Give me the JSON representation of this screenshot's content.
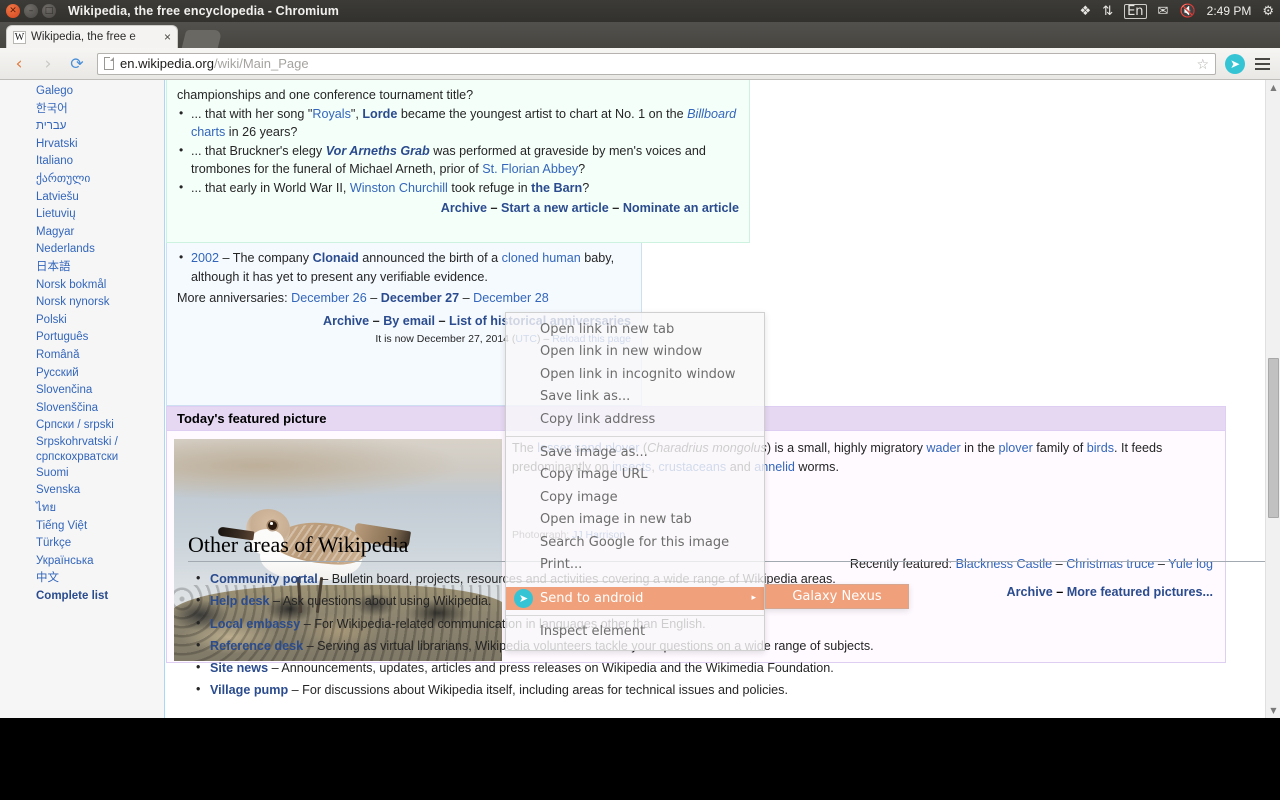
{
  "window": {
    "title": "Wikipedia, the free encyclopedia - Chromium",
    "buttons": {
      "close": "close-button",
      "minimize": "minimize-button",
      "maximize": "maximize-button"
    }
  },
  "tray": {
    "dropbox": "❖",
    "network": "⇅",
    "keyboard": "En",
    "mail": "✉",
    "volume": "🔇",
    "clock": "2:49 PM",
    "system": "⚙"
  },
  "tab": {
    "favicon": "W",
    "title": "Wikipedia, the free e",
    "close": "×"
  },
  "toolbar": {
    "back": "‹",
    "forward": "›",
    "reload": "⟳",
    "url_host": "en.wikipedia.org",
    "url_path": "/wiki/Main_Page",
    "bookmark_star": "☆",
    "telegram": "➤",
    "menu": "menu"
  },
  "sidebar": {
    "languages": [
      {
        "label": "Galego"
      },
      {
        "label": "한국어"
      },
      {
        "label": "עברית"
      },
      {
        "label": "Hrvatski"
      },
      {
        "label": "Italiano"
      },
      {
        "label": "ქართული"
      },
      {
        "label": "Latviešu"
      },
      {
        "label": "Lietuvių"
      },
      {
        "label": "Magyar"
      },
      {
        "label": "Nederlands"
      },
      {
        "label": "日本語"
      },
      {
        "label": "Norsk bokmål"
      },
      {
        "label": "Norsk nynorsk"
      },
      {
        "label": "Polski"
      },
      {
        "label": "Português"
      },
      {
        "label": "Română"
      },
      {
        "label": "Русский"
      },
      {
        "label": "Slovenčina"
      },
      {
        "label": "Slovenščina"
      },
      {
        "label": "Српски / srpski"
      },
      {
        "label": "Srpskohrvatski / српскохрватски"
      },
      {
        "label": "Suomi"
      },
      {
        "label": "Svenska"
      },
      {
        "label": "ไทย"
      },
      {
        "label": "Tiếng Việt"
      },
      {
        "label": "Türkçe"
      },
      {
        "label": "Українська"
      },
      {
        "label": "中文"
      },
      {
        "label": "Complete list",
        "bold": true
      }
    ]
  },
  "did_you_know": {
    "continuation": "championships and one conference tournament title?",
    "items": [
      {
        "p1": "... that with her song \"",
        "l1": "Royals",
        "p2": "\", ",
        "l2": "Lorde",
        "p3": " became the youngest artist to chart at No. 1 on the ",
        "l3": "Billboard",
        "p4": " ",
        "l4": "charts",
        "p5": " in 26 years?"
      },
      {
        "p1": "... that Bruckner's elegy ",
        "l1": "Vor Arneths Grab",
        "p2": " was performed at graveside by men's voices and trombones for the funeral of Michael Arneth, prior of ",
        "l2": "St. Florian Abbey",
        "p3": "?"
      },
      {
        "p1": "... that early in World War II, ",
        "l1": "Winston Churchill",
        "p2": " took refuge in ",
        "l2": "the Barn",
        "p3": "?"
      }
    ],
    "footer": {
      "archive": "Archive",
      "sep": " – ",
      "start": "Start a new article",
      "nominate": "Nominate an article"
    }
  },
  "on_this_day": {
    "item": {
      "year": "2002",
      "dash": " – The company ",
      "link1": "Clonaid",
      "mid": " announced the birth of a ",
      "link2": "cloned human",
      "tail": " baby, although it has yet to present any verifiable evidence."
    },
    "more_label": "More anniversaries: ",
    "dates": [
      "December 26",
      "December 27",
      "December 28"
    ],
    "footer": {
      "archive": "Archive",
      "byemail": "By email",
      "list": "List of historical anniversaries"
    },
    "now_prefix": "It is now December 27, 2014 (",
    "now_utc": "UTC",
    "now_sep": ") – ",
    "reload": "Reload this page"
  },
  "featured_picture": {
    "heading": "Today's featured picture",
    "caption": {
      "p0": "The ",
      "l1": "lesser sand plover",
      "p1": " (",
      "i1": "Charadrius mongolus",
      "p2": ") is a small, highly migratory ",
      "l2": "wader",
      "p3": " in the ",
      "l3": "plover",
      "p4": " family of ",
      "l4": "birds",
      "p5": ". It feeds predominantly on ",
      "l5": "insects",
      "p6": ", ",
      "l6": "crustaceans",
      "p7": " and ",
      "l7": "annelid",
      "p8": " worms."
    },
    "photograph_label": "Photograph: ",
    "photograph_credit": "JJ Harrison",
    "recent_label": "Recently featured: ",
    "recent": [
      "Blackness Castle",
      "Christmas truce",
      "Yule log"
    ],
    "archive": "Archive",
    "more": "More featured pictures..."
  },
  "other_areas": {
    "heading": "Other areas of Wikipedia",
    "items": [
      {
        "link": "Community portal",
        "text": " – Bulletin board, projects, resources and activities covering a wide range of Wikipedia areas."
      },
      {
        "link": "Help desk",
        "text": " – Ask questions about using Wikipedia."
      },
      {
        "link": "Local embassy",
        "text": " – For Wikipedia-related communication in languages other than English."
      },
      {
        "link": "Reference desk",
        "text": " – Serving as virtual librarians, Wikipedia volunteers tackle your questions on a wide range of subjects."
      },
      {
        "link": "Site news",
        "text": " – Announcements, updates, articles and press releases on Wikipedia and the Wikimedia Foundation."
      },
      {
        "link": "Village pump",
        "text": " – For discussions about Wikipedia itself, including areas for technical issues and policies."
      }
    ]
  },
  "context_menu": {
    "group1": [
      "Open link in new tab",
      "Open link in new window",
      "Open link in incognito window",
      "Save link as...",
      "Copy link address"
    ],
    "group2": [
      "Save image as...",
      "Copy image URL",
      "Copy image",
      "Open image in new tab",
      "Search Google for this image",
      "Print..."
    ],
    "highlighted": {
      "label": "Send to android",
      "icon": "➤",
      "arrow": "▸"
    },
    "group3": [
      "Inspect element"
    ],
    "submenu": [
      "Galaxy Nexus"
    ]
  },
  "scrollbar": {
    "up": "▲",
    "down": "▼"
  },
  "colors": {
    "link": "#3366bb",
    "link_bold": "#2a4b8d",
    "dyk_bg": "#f5fffa",
    "otd_bg": "#f5faff",
    "tfp_header": "#e6d8f2",
    "highlight": "#f0a07a"
  }
}
